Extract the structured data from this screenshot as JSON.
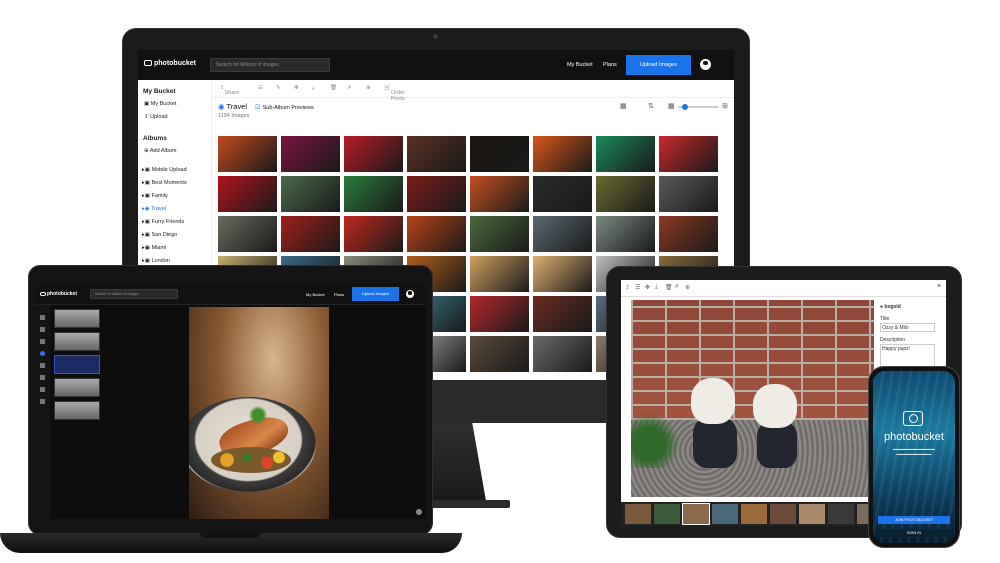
{
  "desktop": {
    "logo": "photobucket",
    "search_placeholder": "Search for billions of images",
    "nav": {
      "my_bucket": "My Bucket",
      "plans": "Plans",
      "upload": "Upload Images"
    },
    "sidebar": {
      "my_bucket_heading": "My Bucket",
      "items": [
        "My Bucket",
        "Upload"
      ],
      "albums_heading": "Albums",
      "add_album": "Add Album",
      "albums": [
        "Mobile Upload",
        "Best Moments",
        "Family",
        "Travel",
        "Furry Friends",
        "San Diego",
        "Miami",
        "London"
      ],
      "selected_album": "Travel"
    },
    "toolbar": {
      "share": "Share",
      "order_prints": "Order Prints"
    },
    "album_title": "Travel",
    "sub_album_label": "Sub-Album Previews",
    "image_count": "1194 Images",
    "thumb_colors": [
      [
        "#c24a1c",
        "#7a1440",
        "#b81c24",
        "#5a3020",
        "#1a1510",
        "#d8561a",
        "#1a8a5a",
        "#c8282a"
      ],
      [
        "#b0141c",
        "#4a6a4a",
        "#2a7a3a",
        "#7a1c18",
        "#c45020",
        "#2a2a2a",
        "#6a6a30",
        "#5a5a5a"
      ],
      [
        "#6a6a60",
        "#a0201a",
        "#c0281c",
        "#b84418",
        "#4a6a3a",
        "#5a6a70",
        "#7a8a80",
        "#8a3a20"
      ],
      [
        "#c8b070",
        "#3a6a8a",
        "#8a8a7a",
        "#b0601a",
        "#d0a060",
        "#e0b070",
        "#c0c0c0",
        "#8a6a3a"
      ],
      [
        "#6a8a9a",
        "#b09070",
        "#c86a20",
        "#3a7a8a",
        "#b4282a",
        "#6a2a20",
        "#5a6a80",
        "#2a2a2a"
      ],
      [
        "#7090a0",
        "#3a3a3a",
        "#c0281c",
        "#a0a0a0",
        "#5a4a3a",
        "#6a6a6a",
        "#8a7a6a",
        "#3a4a5a"
      ]
    ]
  },
  "laptop": {
    "logo": "photobucket",
    "search_placeholder": "Search for billions of images",
    "nav": {
      "my_bucket": "My Bucket",
      "plans": "Plans",
      "upload": "Upload Images"
    }
  },
  "tablet": {
    "panel_user": "begold",
    "title_label": "Title",
    "title_value": "Ozzy & Milo",
    "description_label": "Description",
    "description_value": "Happy pups!"
  },
  "phone": {
    "brand": "photobucket",
    "join_button": "JOIN PHOTOBUCKET",
    "signin_button": "SIGN IN"
  }
}
